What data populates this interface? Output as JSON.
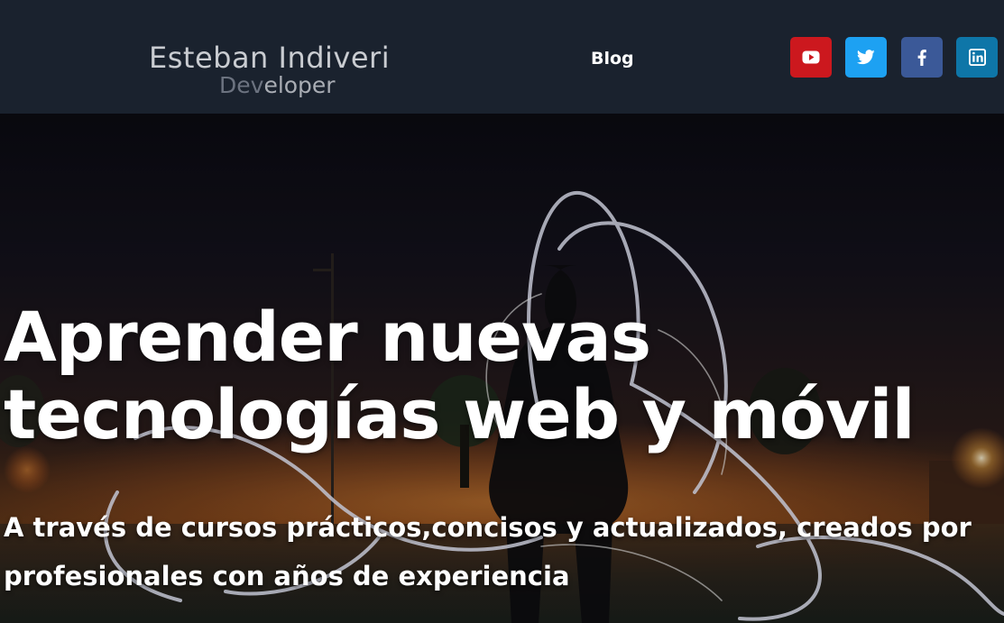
{
  "header": {
    "logo_name": "Esteban Indiveri",
    "logo_sub_faded": "Dev",
    "logo_sub_rest": "eloper",
    "nav": [
      {
        "label": "Blog"
      }
    ],
    "social": [
      {
        "icon": "youtube-icon",
        "color": "#cc181e"
      },
      {
        "icon": "twitter-icon",
        "color": "#1da1f2"
      },
      {
        "icon": "facebook-icon",
        "color": "#3b5998"
      },
      {
        "icon": "linkedin-icon",
        "color": "#0e76a8"
      }
    ]
  },
  "hero": {
    "title": "Aprender nuevas tecnologías web y móvil",
    "subtitle": "A través de cursos prácticos,concisos y actualizados, creados por profesionales con años de experiencia"
  }
}
